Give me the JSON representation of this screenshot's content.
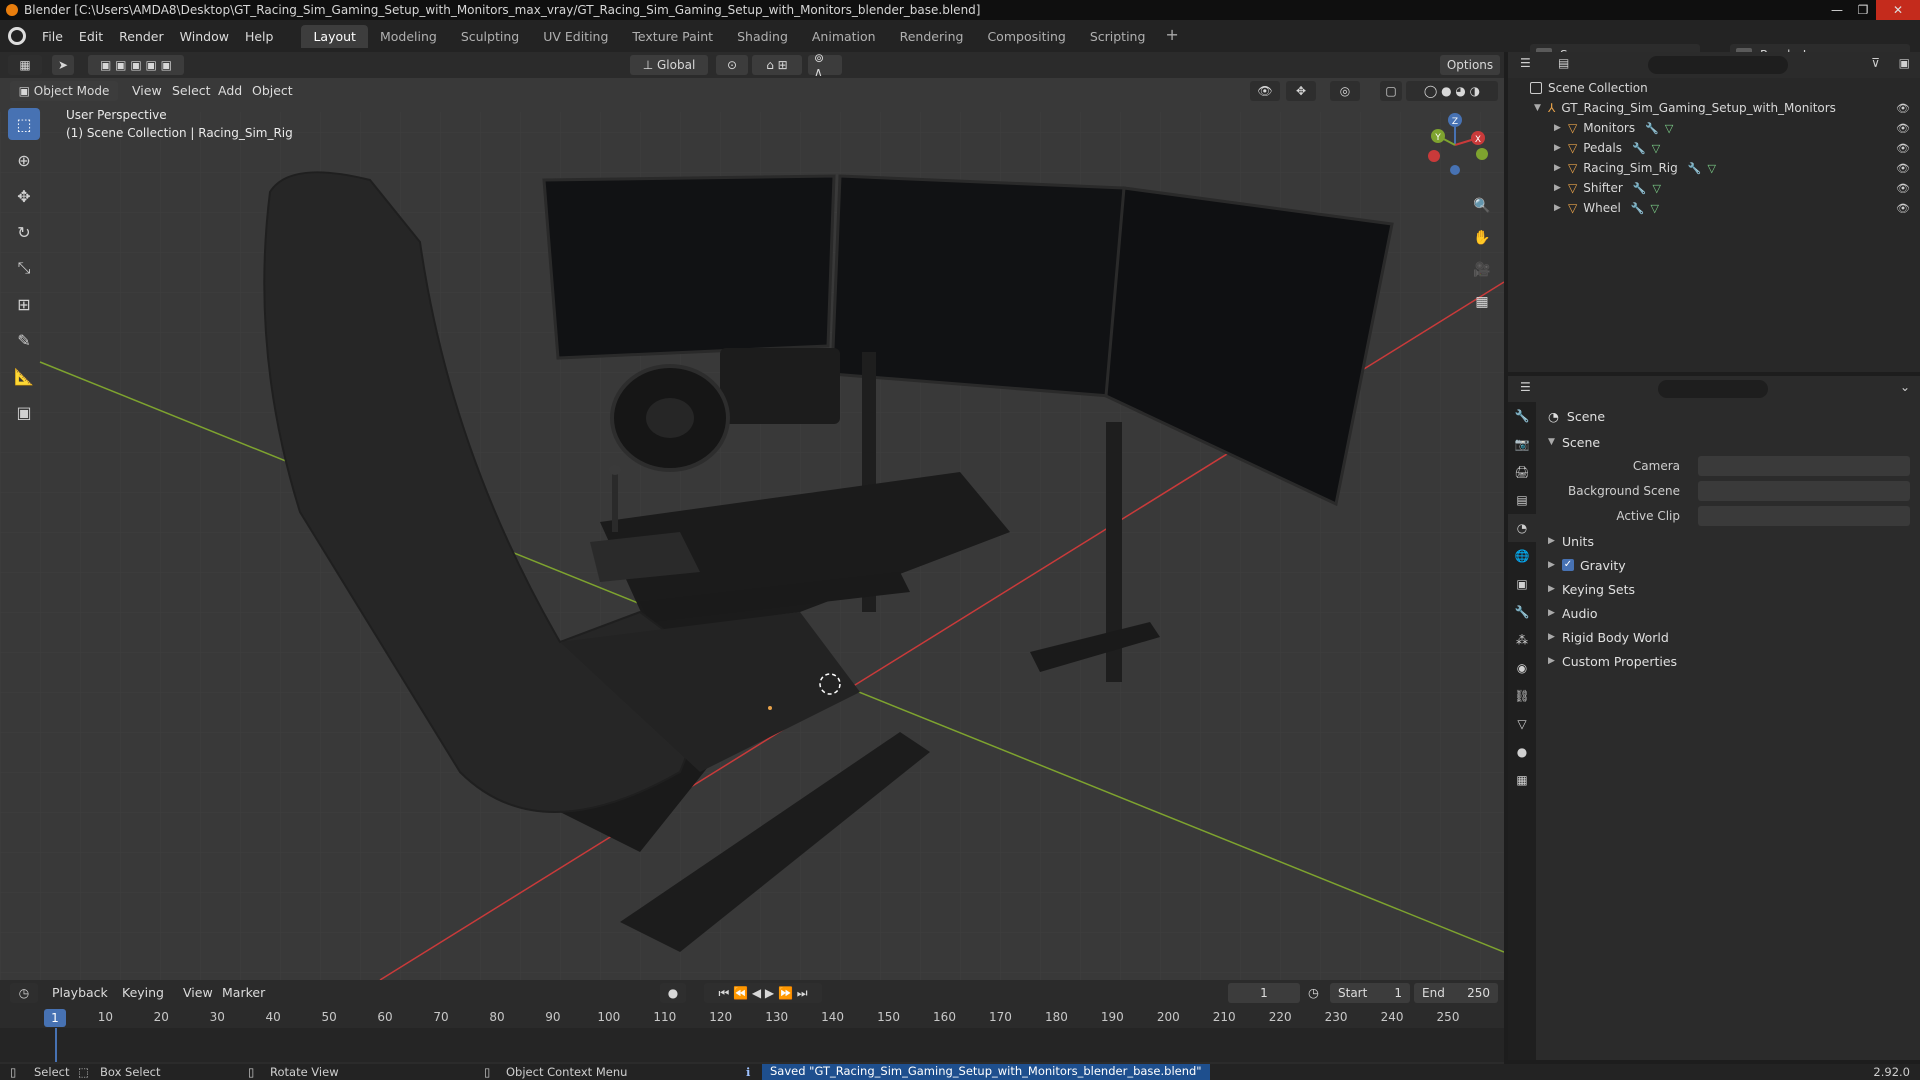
{
  "window": {
    "title": "Blender [C:\\Users\\AMDA8\\Desktop\\GT_Racing_Sim_Gaming_Setup_with_Monitors_max_vray/GT_Racing_Sim_Gaming_Setup_with_Monitors_blender_base.blend]"
  },
  "menu": [
    "File",
    "Edit",
    "Render",
    "Window",
    "Help"
  ],
  "workspaces": [
    "Layout",
    "Modeling",
    "Sculpting",
    "UV Editing",
    "Texture Paint",
    "Shading",
    "Animation",
    "Rendering",
    "Compositing",
    "Scripting"
  ],
  "active_workspace": "Layout",
  "scene_selector": "Scene",
  "view_layer_selector": "RenderLayer",
  "viewport": {
    "transform_orientation": "Global",
    "options_label": "Options",
    "mode": "Object Mode",
    "header_menus": [
      "View",
      "Select",
      "Add",
      "Object"
    ],
    "perspective_label": "User Perspective",
    "context_label": "(1) Scene Collection | Racing_Sim_Rig",
    "gizmo_axes": {
      "x": "X",
      "y": "Y",
      "z": "Z"
    }
  },
  "toolbar": [
    "select-box-icon",
    "cursor-icon",
    "move-icon",
    "rotate-icon",
    "scale-icon",
    "transform-icon",
    "annotate-icon",
    "measure-icon",
    "add-cube-icon"
  ],
  "outliner": {
    "root": "Scene Collection",
    "collection": "GT_Racing_Sim_Gaming_Setup_with_Monitors",
    "objects": [
      "Monitors",
      "Pedals",
      "Racing_Sim_Rig",
      "Shifter",
      "Wheel"
    ]
  },
  "properties": {
    "context_title": "Scene",
    "panel_title": "Scene",
    "fields": [
      {
        "label": "Camera",
        "value": ""
      },
      {
        "label": "Background Scene",
        "value": ""
      },
      {
        "label": "Active Clip",
        "value": ""
      }
    ],
    "subpanels": [
      "Units",
      "Gravity",
      "Keying Sets",
      "Audio",
      "Rigid Body World",
      "Custom Properties"
    ],
    "gravity_checked": true
  },
  "timeline": {
    "menus": [
      "Playback",
      "Keying",
      "View",
      "Marker"
    ],
    "current_frame": "1",
    "start_label": "Start",
    "start": "1",
    "end_label": "End",
    "end": "250",
    "ticks": [
      "1",
      "10",
      "20",
      "30",
      "40",
      "50",
      "60",
      "70",
      "80",
      "90",
      "100",
      "110",
      "120",
      "130",
      "140",
      "150",
      "160",
      "170",
      "180",
      "190",
      "200",
      "210",
      "220",
      "230",
      "240",
      "250"
    ]
  },
  "statusbar": {
    "select": "Select",
    "box_select": "Box Select",
    "rotate_view": "Rotate View",
    "context_menu": "Object Context Menu",
    "message": "Saved \"GT_Racing_Sim_Gaming_Setup_with_Monitors_blender_base.blend\"",
    "version": "2.92.0"
  },
  "colors": {
    "accent": "#4772b3",
    "axis_x": "#c93a3a",
    "axis_y": "#7ea32f",
    "object_icon": "#e8a24a"
  }
}
